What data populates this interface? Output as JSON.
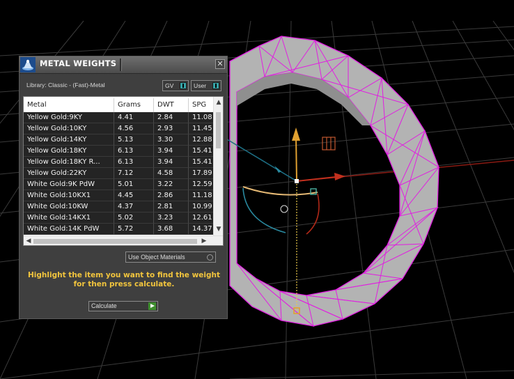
{
  "panel": {
    "title": "METAL WEIGHTS",
    "close_glyph": "✕",
    "library_label": "Library: Classic - (Fast)-Metal",
    "gv_label": "GV",
    "user_label": "User",
    "columns": [
      "Metal",
      "Grams",
      "DWT",
      "SPG"
    ],
    "rows": [
      {
        "metal": "Yellow Gold:9KY",
        "grams": "4.41",
        "dwt": "2.84",
        "spg": "11.08"
      },
      {
        "metal": "Yellow Gold:10KY",
        "grams": "4.56",
        "dwt": "2.93",
        "spg": "11.45"
      },
      {
        "metal": "Yellow Gold:14KY",
        "grams": "5.13",
        "dwt": "3.30",
        "spg": "12.88"
      },
      {
        "metal": "Yellow Gold:18KY",
        "grams": "6.13",
        "dwt": "3.94",
        "spg": "15.41"
      },
      {
        "metal": "Yellow Gold:18KY R...",
        "grams": "6.13",
        "dwt": "3.94",
        "spg": "15.41"
      },
      {
        "metal": "Yellow Gold:22KY",
        "grams": "7.12",
        "dwt": "4.58",
        "spg": "17.89"
      },
      {
        "metal": "White Gold:9K PdW",
        "grams": "5.01",
        "dwt": "3.22",
        "spg": "12.59"
      },
      {
        "metal": "White Gold:10KX1",
        "grams": "4.45",
        "dwt": "2.86",
        "spg": "11.18"
      },
      {
        "metal": "White Gold:10KW",
        "grams": "4.37",
        "dwt": "2.81",
        "spg": "10.99"
      },
      {
        "metal": "White Gold:14KX1",
        "grams": "5.02",
        "dwt": "3.23",
        "spg": "12.61"
      },
      {
        "metal": "White Gold:14K PdW",
        "grams": "5.72",
        "dwt": "3.68",
        "spg": "14.37"
      }
    ],
    "use_object_materials_label": "Use Object Materials",
    "hint_line1": "Highlight the item you want to find the weight",
    "hint_line2": "for then press calculate.",
    "calculate_label": "Calculate",
    "icon": "metal-weights-app-icon"
  },
  "colors": {
    "hint": "#f2c53d",
    "toggle_on": "#37a3a6",
    "ring_wire": "#e11ee1",
    "axis_x": "#c0301e",
    "axis_y": "#e0a030",
    "axis_z": "#2a8aa0"
  }
}
